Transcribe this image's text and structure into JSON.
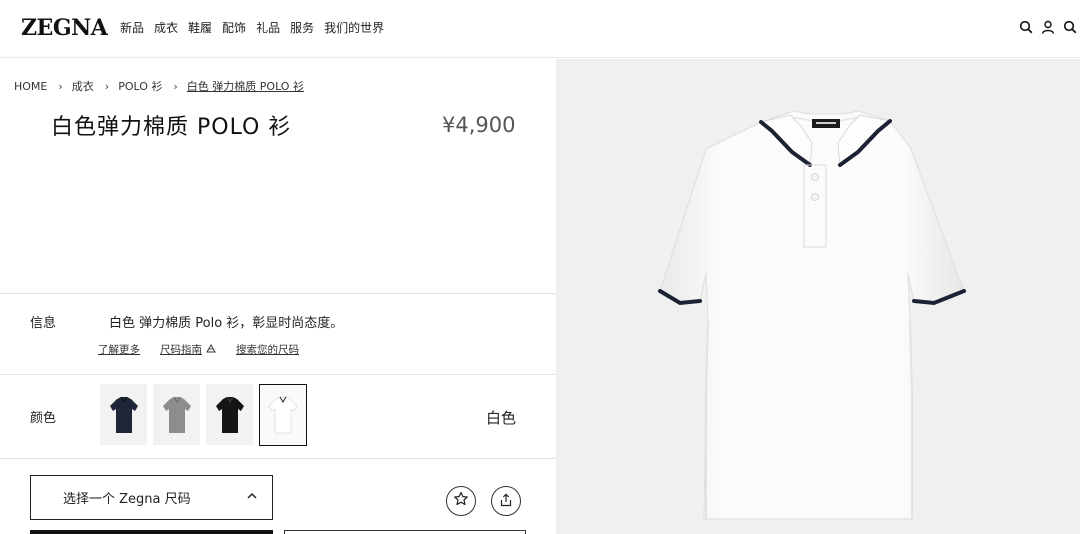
{
  "brand": {
    "logo": "ZEGNA"
  },
  "nav": {
    "items": [
      "新品",
      "成衣",
      "鞋履",
      "配饰",
      "礼品",
      "服务",
      "我们的世界"
    ]
  },
  "header_icons": [
    "search-icon",
    "account-icon",
    "search-icon-secondary"
  ],
  "breadcrumb": {
    "items": [
      "HOME",
      "成衣",
      "POLO 衫",
      "白色 弹力棉质 POLO 衫"
    ],
    "separator": "›"
  },
  "product": {
    "title": "白色弹力棉质 POLO 衫",
    "price": "¥4,900"
  },
  "info": {
    "label": "信息",
    "description": "白色 弹力棉质 Polo 衫，彰显时尚态度。",
    "links": [
      "了解更多",
      "尺码指南",
      "搜索您的尺码"
    ]
  },
  "colors": {
    "label": "颜色",
    "selected_name": "白色",
    "swatches": [
      {
        "name": "navy",
        "hex": "#1f2638"
      },
      {
        "name": "grey",
        "hex": "#8d8d8d"
      },
      {
        "name": "black",
        "hex": "#151515"
      },
      {
        "name": "white",
        "hex": "#ffffff"
      }
    ]
  },
  "size": {
    "placeholder": "选择一个 Zegna 尺码"
  },
  "accent": {
    "text": "#222222",
    "border": "#e2e2e2",
    "image_bg": "#f0f0f0",
    "collar_trim": "#1b2233"
  }
}
